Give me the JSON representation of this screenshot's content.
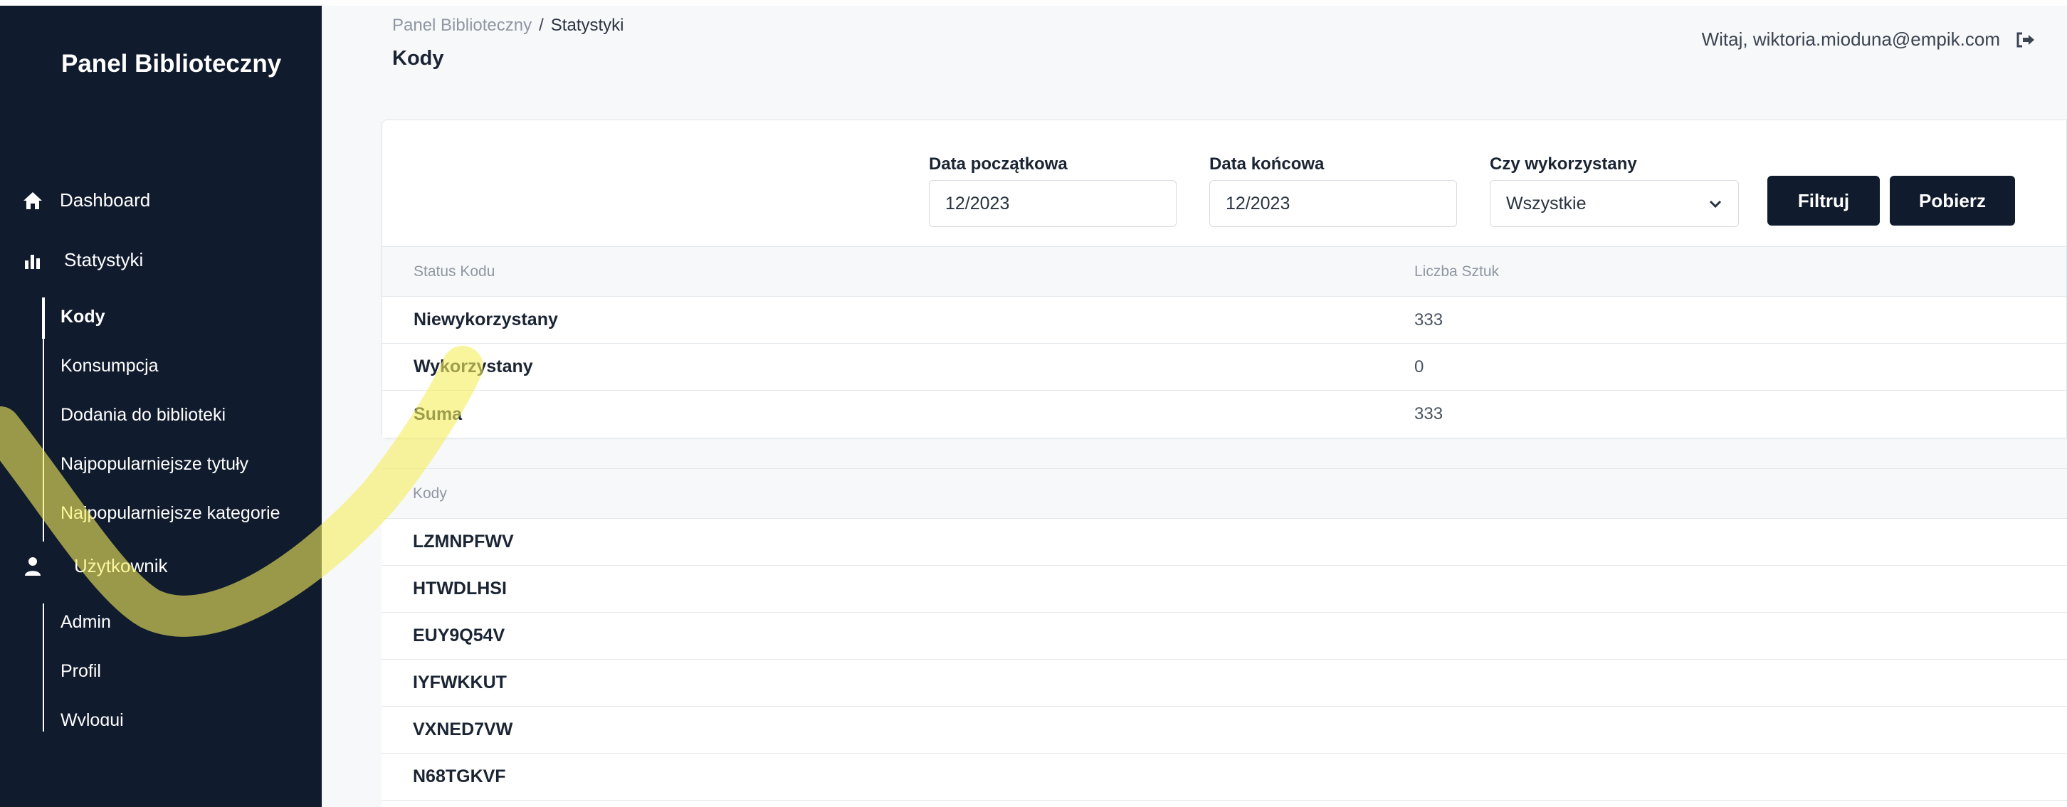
{
  "sidebar": {
    "brand": "Panel Biblioteczny",
    "items": [
      {
        "label": "Dashboard",
        "icon": "home-icon"
      },
      {
        "label": "Statystyki",
        "icon": "bar-chart-icon"
      },
      {
        "label": "Użytkownik",
        "icon": "user-icon"
      }
    ],
    "stats_sub": [
      "Kody",
      "Konsumpcja",
      "Dodania do biblioteki",
      "Najpopularniejsze tytuły",
      "Najpopularniejsze kategorie"
    ],
    "user_sub": [
      "Admin",
      "Profil",
      "Wyloguj"
    ]
  },
  "header": {
    "breadcrumb_root": "Panel Biblioteczny",
    "breadcrumb_sep": "/",
    "breadcrumb_current": "Statystyki",
    "title": "Kody",
    "welcome": "Witaj, wiktoria.mioduna@empik.com",
    "logout_icon": "logout-icon"
  },
  "filters": {
    "start_label": "Data początkowa",
    "start_value": "12/2023",
    "end_label": "Data końcowa",
    "end_value": "12/2023",
    "used_label": "Czy wykorzystany",
    "used_value": "Wszystkie",
    "filter_button": "Filtruj",
    "download_button": "Pobierz"
  },
  "summary_table": {
    "columns": [
      "Status Kodu",
      "Liczba Sztuk"
    ],
    "rows": [
      {
        "status": "Niewykorzystany",
        "count": "333"
      },
      {
        "status": "Wykorzystany",
        "count": "0"
      },
      {
        "status": "Suma",
        "count": "333"
      }
    ]
  },
  "codes_table": {
    "column": "Kody",
    "rows": [
      "LZMNPFWV",
      "HTWDLHSI",
      "EUY9Q54V",
      "IYFWKKUT",
      "VXNED7VW",
      "N68TGKVF"
    ]
  },
  "colors": {
    "sidebar_bg": "#111b2e",
    "button_bg": "#111b2e",
    "highlight": "#f5ef5c"
  }
}
